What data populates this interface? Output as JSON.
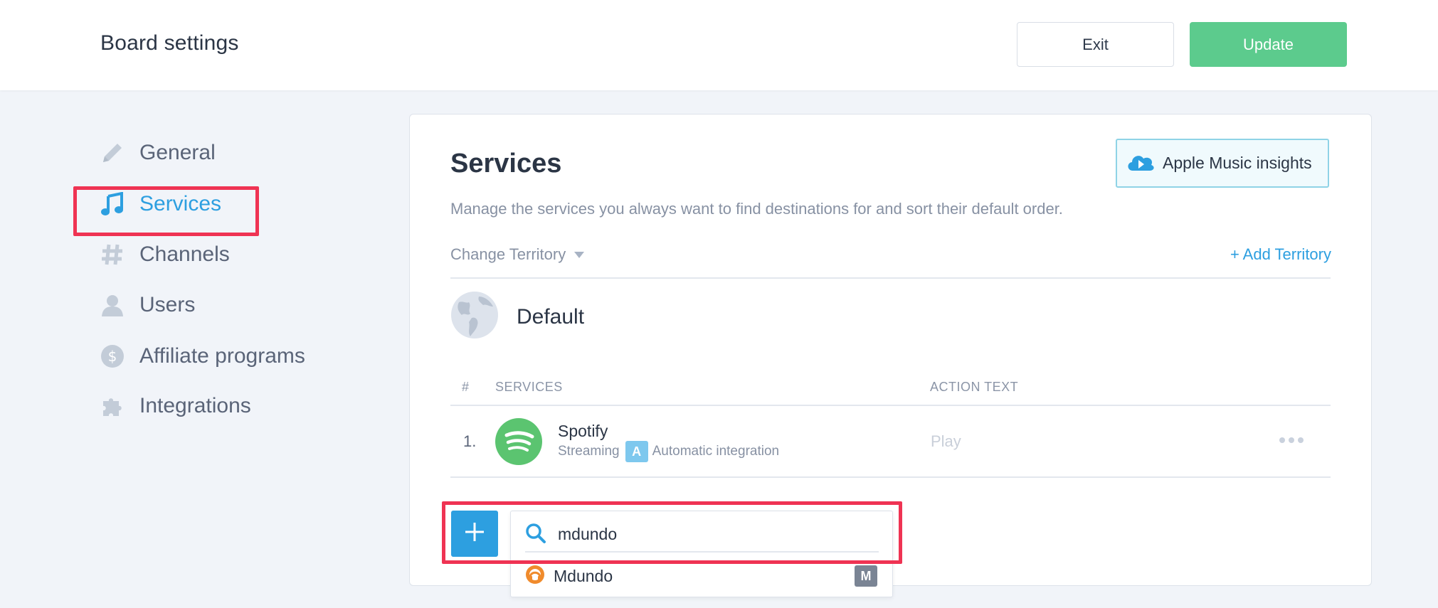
{
  "header": {
    "title": "Board settings",
    "exit_label": "Exit",
    "update_label": "Update"
  },
  "sidebar": {
    "items": [
      {
        "label": "General",
        "icon": "pencil-icon"
      },
      {
        "label": "Services",
        "icon": "music-note-icon",
        "active": true
      },
      {
        "label": "Channels",
        "icon": "hash-icon"
      },
      {
        "label": "Users",
        "icon": "user-icon"
      },
      {
        "label": "Affiliate programs",
        "icon": "dollar-icon"
      },
      {
        "label": "Integrations",
        "icon": "puzzle-icon"
      }
    ]
  },
  "services": {
    "title": "Services",
    "insights_label": "Apple Music insights",
    "description": "Manage the services you always want to find destinations for and sort their default order.",
    "change_territory": "Change Territory",
    "add_territory": "+ Add Territory",
    "territory_name": "Default",
    "table": {
      "headers": {
        "num": "#",
        "services": "SERVICES",
        "action": "ACTION TEXT"
      },
      "rows": [
        {
          "num": "1.",
          "name": "Spotify",
          "type": "Streaming",
          "badge": "A",
          "integration": "Automatic integration",
          "action_text": "Play"
        }
      ]
    }
  },
  "search": {
    "value": "mdundo",
    "results": [
      {
        "label": "Mdundo",
        "badge": "M"
      }
    ]
  },
  "colors": {
    "accent": "#2d9fe0",
    "update_green": "#5ccb8d",
    "highlight_red": "#ef3353",
    "spotify_green": "#5bc470",
    "mdundo_orange": "#f08b2c"
  }
}
